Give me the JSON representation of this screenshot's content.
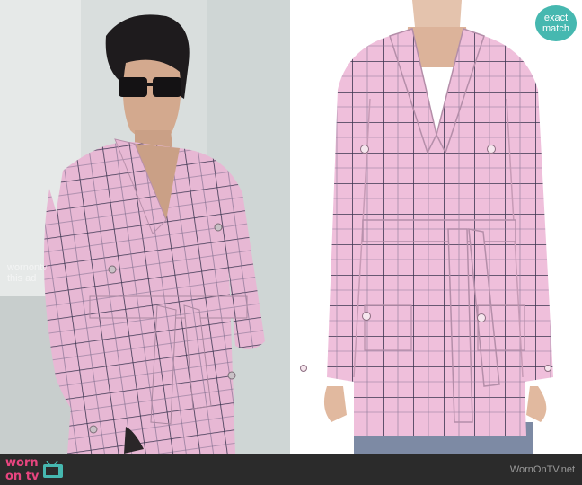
{
  "badge": {
    "line1": "exact",
    "line2": "match"
  },
  "watermark": {
    "line1": "wornontv",
    "line2": "this ad"
  },
  "footer": {
    "logo_line1": "worn",
    "logo_line2": "on tv",
    "url": "WornOnTV.net"
  },
  "colors": {
    "jacket": "#e9b9d6",
    "grid_line": "#3b3550",
    "accent": "#e8457f",
    "badge": "#46b8b0"
  }
}
